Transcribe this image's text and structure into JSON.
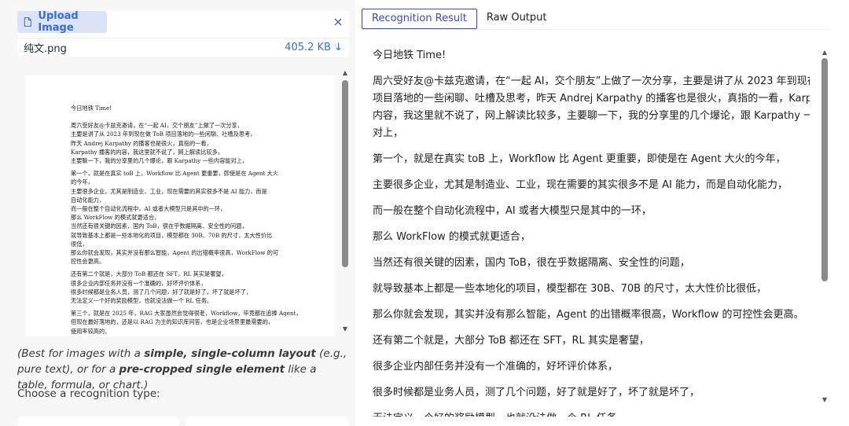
{
  "upload": {
    "button_label": "Upload Image",
    "close_icon": "×",
    "file_name": "纯文.png",
    "file_size": "405.2 KB ↓"
  },
  "preview": {
    "title": "今日地铁 Time!",
    "paragraphs": [
      "周六受好友@卡兹克邀请，在“一起 AI，交个朋友”上做了一次分享，\n主要是讲了从 2023 年到现在做 ToB 项目落地的一些闲聊、吐槽及思考，\n昨天 Andrej Karpathy 的播客也是很火，真指的一看，\nKarpathy 播客的内容，我这里就不说了，网上解读比较多，\n主要聊一下，我的分享里的几个爆论，跟 Karpathy 一些内容能对上，",
      "第一个，就是在真实 toB 上，Workflow 比 Agent 更重要，即使是在 Agent 大火\n的今年，\n主要很多企业，尤其是制造业、工业，现在需要的其实很多不是 AI 能力，而是\n自动化能力，\n而一般在整个自动化流程中，AI 或者大模型只是其中的一环，\n那么 WorkFlow 的模式就更适合，\n当然还有很关键的因素，国内 ToB，很在乎数据隔离、安全性的问题，\n就导致基本上都是一些本地化的项目，模型都在 30B、70B 的尺寸，太大性价比\n很低，\n那么你就会发现，其实并没有那么智能，Agent 的出错概率很高，WorkFlow 的可\n控性会更高。",
      "还有第二个就是，大部分 ToB 都还在 SFT，RL 其实是奢望，\n很多企业内部任务并没有一个准确的，好坏评价体系，\n很多时候都是业务人员，测了几个问题，好了就是好了，坏了就是坏了，\n无法定义一个好的奖励模型，也就没法做一个 RL 任务。",
      "第三个，就是在 2025 年，RAG 大家虽然会觉得很老，Workflow，毕竟都在追捧 Agent，\n但现在最好落地的，还是以 RAG 为主的知识库问答，也是企业场景里最需要的，\n使用率较高的，\n虽然很多花样，从 0 到 1 很容易，但在往上会非常难。"
    ]
  },
  "hint": {
    "p1": "(Best for images with a ",
    "b1": "simple, single-column layout",
    "p2": " (e.g., pure text), or for a ",
    "b2": "pre-cropped single element",
    "p3": " like a table, formula, or chart.)"
  },
  "choose_label": "Choose a recognition type:",
  "tabs": {
    "result": "Recognition Result",
    "raw": "Raw Output"
  },
  "result": {
    "lines": [
      "今日地铁 Time!",
      [
        "周六受好友@卡兹克邀请，在“一起 AI，交个朋友”上做了一次分享，主要是讲了从 2023 年到现在做 ToB",
        "项目落地的一些闲聊、吐槽及思考，昨天 Andrej Karpathy 的播客也是很火，真指的一看，Karpathy 播客的",
        "内容，我这里就不说了，网上解读比较多，主要聊一下，我的分享里的几个爆论，跟 Karpathy 一些内容能",
        "对上，"
      ],
      "第一个，就是在真实 toB 上，Workflow 比 Agent 更重要，即使是在 Agent 大火的今年，",
      "主要很多企业，尤其是制造业、工业，现在需要的其实很多不是 AI 能力，而是自动化能力，",
      "而一般在整个自动化流程中，AI 或者大模型只是其中的一环，",
      "那么 WorkFlow 的模式就更适合，",
      "当然还有很关键的因素，国内 ToB，很在乎数据隔离、安全性的问题，",
      "就导致基本上都是一些本地化的项目，模型都在 30B、70B 的尺寸，太大性价比很低，",
      "那么你就会发现，其实并没有那么智能，Agent 的出错概率很高，Workflow 的可控性会更高。",
      "还有第二个就是，大部分 ToB 都还在 SFT，RL 其实是奢望，",
      "很多企业内部任务并没有一个准确的，好坏评价体系，",
      "很多时候都是业务人员，测了几个问题，好了就是好了，坏了就是坏了，",
      "无法定义一个好的奖励模型，也就没法做一个 RL 任务。"
    ]
  },
  "icons": {
    "file": "file-icon",
    "close": "close-icon",
    "scroll_up": "chevron-up-icon",
    "scroll_down": "chevron-down-icon"
  },
  "colors": {
    "accent": "#3b4db0",
    "upload_bg": "#dbe4f6",
    "upload_text": "#3b6cd1",
    "panel_bg": "#f7f7f8"
  }
}
